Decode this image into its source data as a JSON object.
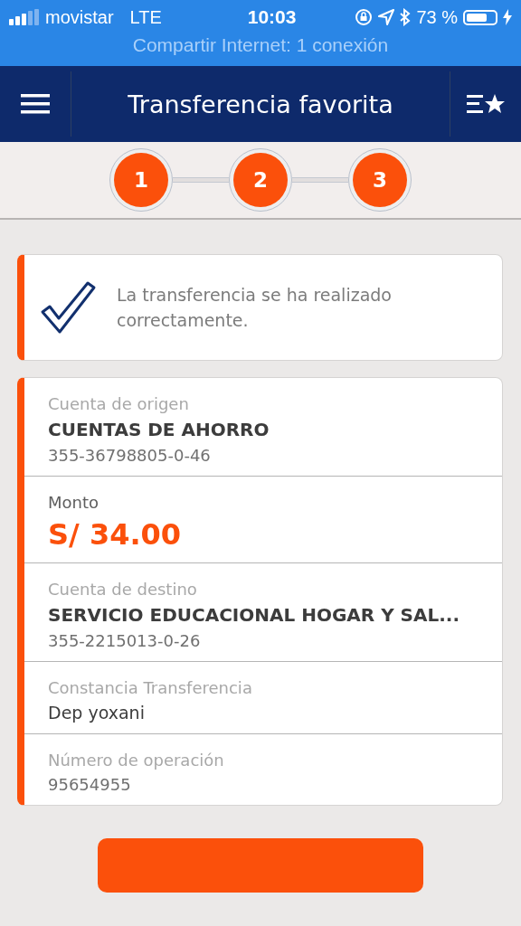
{
  "status_bar": {
    "carrier": "movistar",
    "network": "LTE",
    "time": "10:03",
    "battery": "73 %"
  },
  "hotspot_banner": "Compartir Internet: 1 conexión",
  "nav": {
    "title": "Transferencia favorita"
  },
  "steps": [
    {
      "label": "1",
      "done": true
    },
    {
      "label": "2",
      "done": true
    },
    {
      "label": "3",
      "done": true
    }
  ],
  "message": "La transferencia se ha realizado correctamente.",
  "details": [
    {
      "lines": [
        {
          "kind": "label",
          "text": "Cuenta de origen"
        },
        {
          "kind": "title",
          "text": "CUENTAS DE AHORRO"
        },
        {
          "kind": "number",
          "text": "355-36798805-0-46"
        }
      ]
    },
    {
      "lines": [
        {
          "kind": "strong-label",
          "text": "Monto"
        },
        {
          "kind": "amount",
          "text": "S/ 34.00"
        }
      ]
    },
    {
      "lines": [
        {
          "kind": "label",
          "text": "Cuenta de destino"
        },
        {
          "kind": "title",
          "text": "SERVICIO EDUCACIONAL HOGAR Y SAL..."
        },
        {
          "kind": "number",
          "text": "355-2215013-0-26"
        }
      ]
    },
    {
      "lines": [
        {
          "kind": "label",
          "text": "Constancia Transferencia"
        },
        {
          "kind": "text",
          "text": "Dep yoxani"
        }
      ]
    },
    {
      "lines": [
        {
          "kind": "label",
          "text": "Número de operación"
        },
        {
          "kind": "number",
          "text": "95654955"
        }
      ]
    }
  ]
}
